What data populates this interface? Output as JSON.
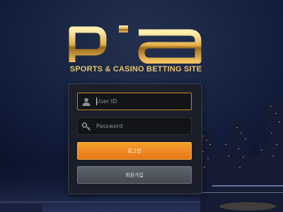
{
  "brand": {
    "logo_text": "pia",
    "tagline": "SPORTS & CASINO BETTING SITE"
  },
  "login_form": {
    "user_id_placeholder": "User ID",
    "password_placeholder": "Password",
    "login_button": "로그인",
    "join_button": "회원가입"
  },
  "colors": {
    "accent_orange": "#ee8a22",
    "logo_gold": "#d9a43c",
    "panel_bg": "#1c1f26"
  },
  "icons": {
    "user": "user-icon",
    "password": "key-icon"
  }
}
